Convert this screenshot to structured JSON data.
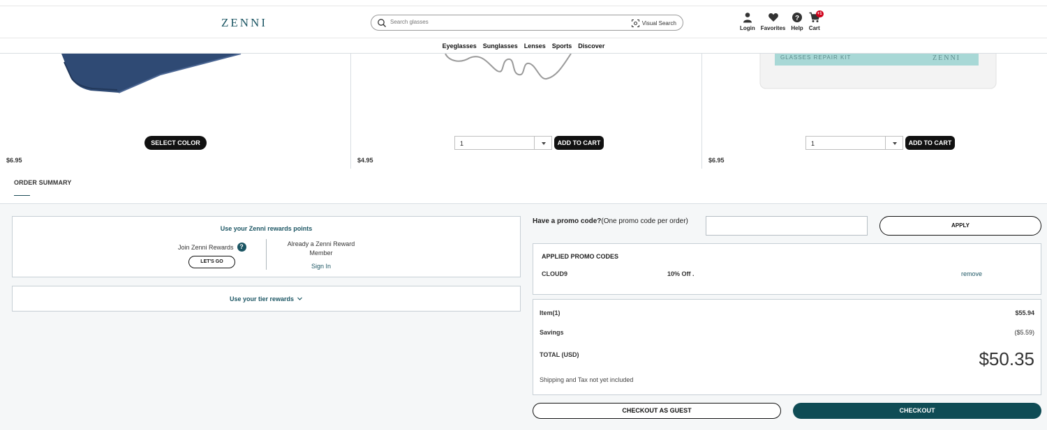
{
  "header": {
    "logo_text": "ZENNI",
    "search": {
      "placeholder": "Search glasses",
      "visual_search_label": "Visual Search"
    },
    "icons": [
      {
        "label": "Login",
        "icon": "user-icon"
      },
      {
        "label": "Favorites",
        "icon": "heart-icon"
      },
      {
        "label": "Help",
        "icon": "help-icon"
      },
      {
        "label": "Cart",
        "icon": "cart-icon",
        "badge": "+1"
      }
    ]
  },
  "nav": {
    "items": [
      "Eyeglasses",
      "Sunglasses",
      "Lenses",
      "Sports",
      "Discover"
    ]
  },
  "products": [
    {
      "price": "$6.95",
      "action_label": "SELECT COLOR"
    },
    {
      "price": "$4.95",
      "quantity": "1",
      "action_label": "ADD TO CART"
    },
    {
      "price": "$6.95",
      "quantity": "1",
      "action_label": "ADD TO CART",
      "image_text": "GLASSES REPAIR KIT",
      "image_brand": "ZENNI"
    }
  ],
  "order_summary": {
    "title": "ORDER SUMMARY",
    "rewards": {
      "title": "Use your Zenni rewards points",
      "join_label": "Join Zenni Rewards",
      "lets_go_label": "LET'S GO",
      "member_label": "Already a Zenni Reward Member",
      "sign_in_label": "Sign In"
    },
    "tier_label": "Use your tier rewards",
    "promo": {
      "label_bold": "Have a promo code?",
      "label_note": "(One promo code per order)",
      "input_value": "",
      "apply_label": "APPLY"
    },
    "applied": {
      "title": "APPLIED PROMO CODES",
      "code": "CLOUD9",
      "discount": "10% Off .",
      "remove_label": "remove"
    },
    "totals": {
      "item_label": "Item(1)",
      "item_value": "$55.94",
      "savings_label": "Savings",
      "savings_value": "($5.59)",
      "total_label": "TOTAL (USD)",
      "total_value": "$50.35",
      "shipping_note": "Shipping and Tax not yet included"
    },
    "guest_label": "CHECKOUT AS GUEST",
    "checkout_label": "CHECKOUT"
  },
  "colors": {
    "accent": "#0f4c55",
    "link": "#1b5563",
    "badge": "#d0021b"
  }
}
